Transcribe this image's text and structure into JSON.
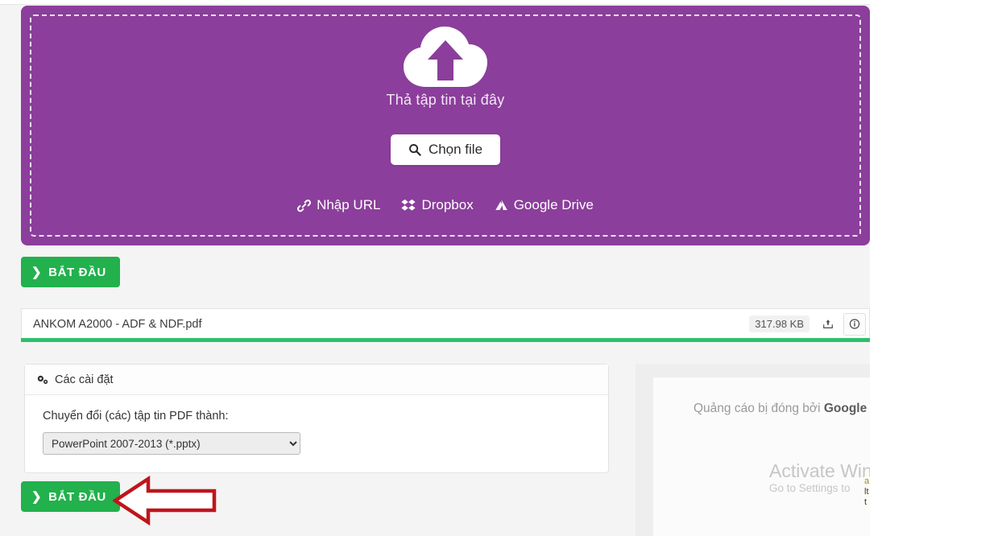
{
  "dropzone": {
    "drop_text": "Thả tập tin tại đây",
    "choose_button": "Chọn file",
    "services": [
      {
        "label": "Nhập URL",
        "icon": "link-icon"
      },
      {
        "label": "Dropbox",
        "icon": "dropbox-icon"
      },
      {
        "label": "Google Drive",
        "icon": "google-drive-icon"
      }
    ],
    "bg_color": "#8b3e9b"
  },
  "actions": {
    "start_top": "BẮT ĐẦU",
    "start_bottom": "BẮT ĐẦU",
    "chevron": "❯",
    "green_color": "#22b14c"
  },
  "file": {
    "name": "ANKOM A2000 - ADF & NDF.pdf",
    "size": "317.98 KB",
    "upload_icon": "upload-export-icon",
    "info_icon": "info-circle-icon",
    "progress_color": "#2fbf6e"
  },
  "settings": {
    "title": "Các cài đặt",
    "gear_icon": "cogs-icon",
    "label": "Chuyển đổi (các) tập tin PDF thành:",
    "selected_format": "PowerPoint 2007-2013 (*.pptx)",
    "options": [
      "PowerPoint 2007-2013 (*.pptx)"
    ]
  },
  "ad": {
    "text_prefix": "Quảng cáo bị đóng bởi ",
    "brand": "Google"
  },
  "watermark": {
    "line1": "Activate Wind",
    "line2": "Go to Settings to "
  },
  "sliver": {
    "l1": "a",
    "l2": "lt",
    "l3": "t"
  }
}
